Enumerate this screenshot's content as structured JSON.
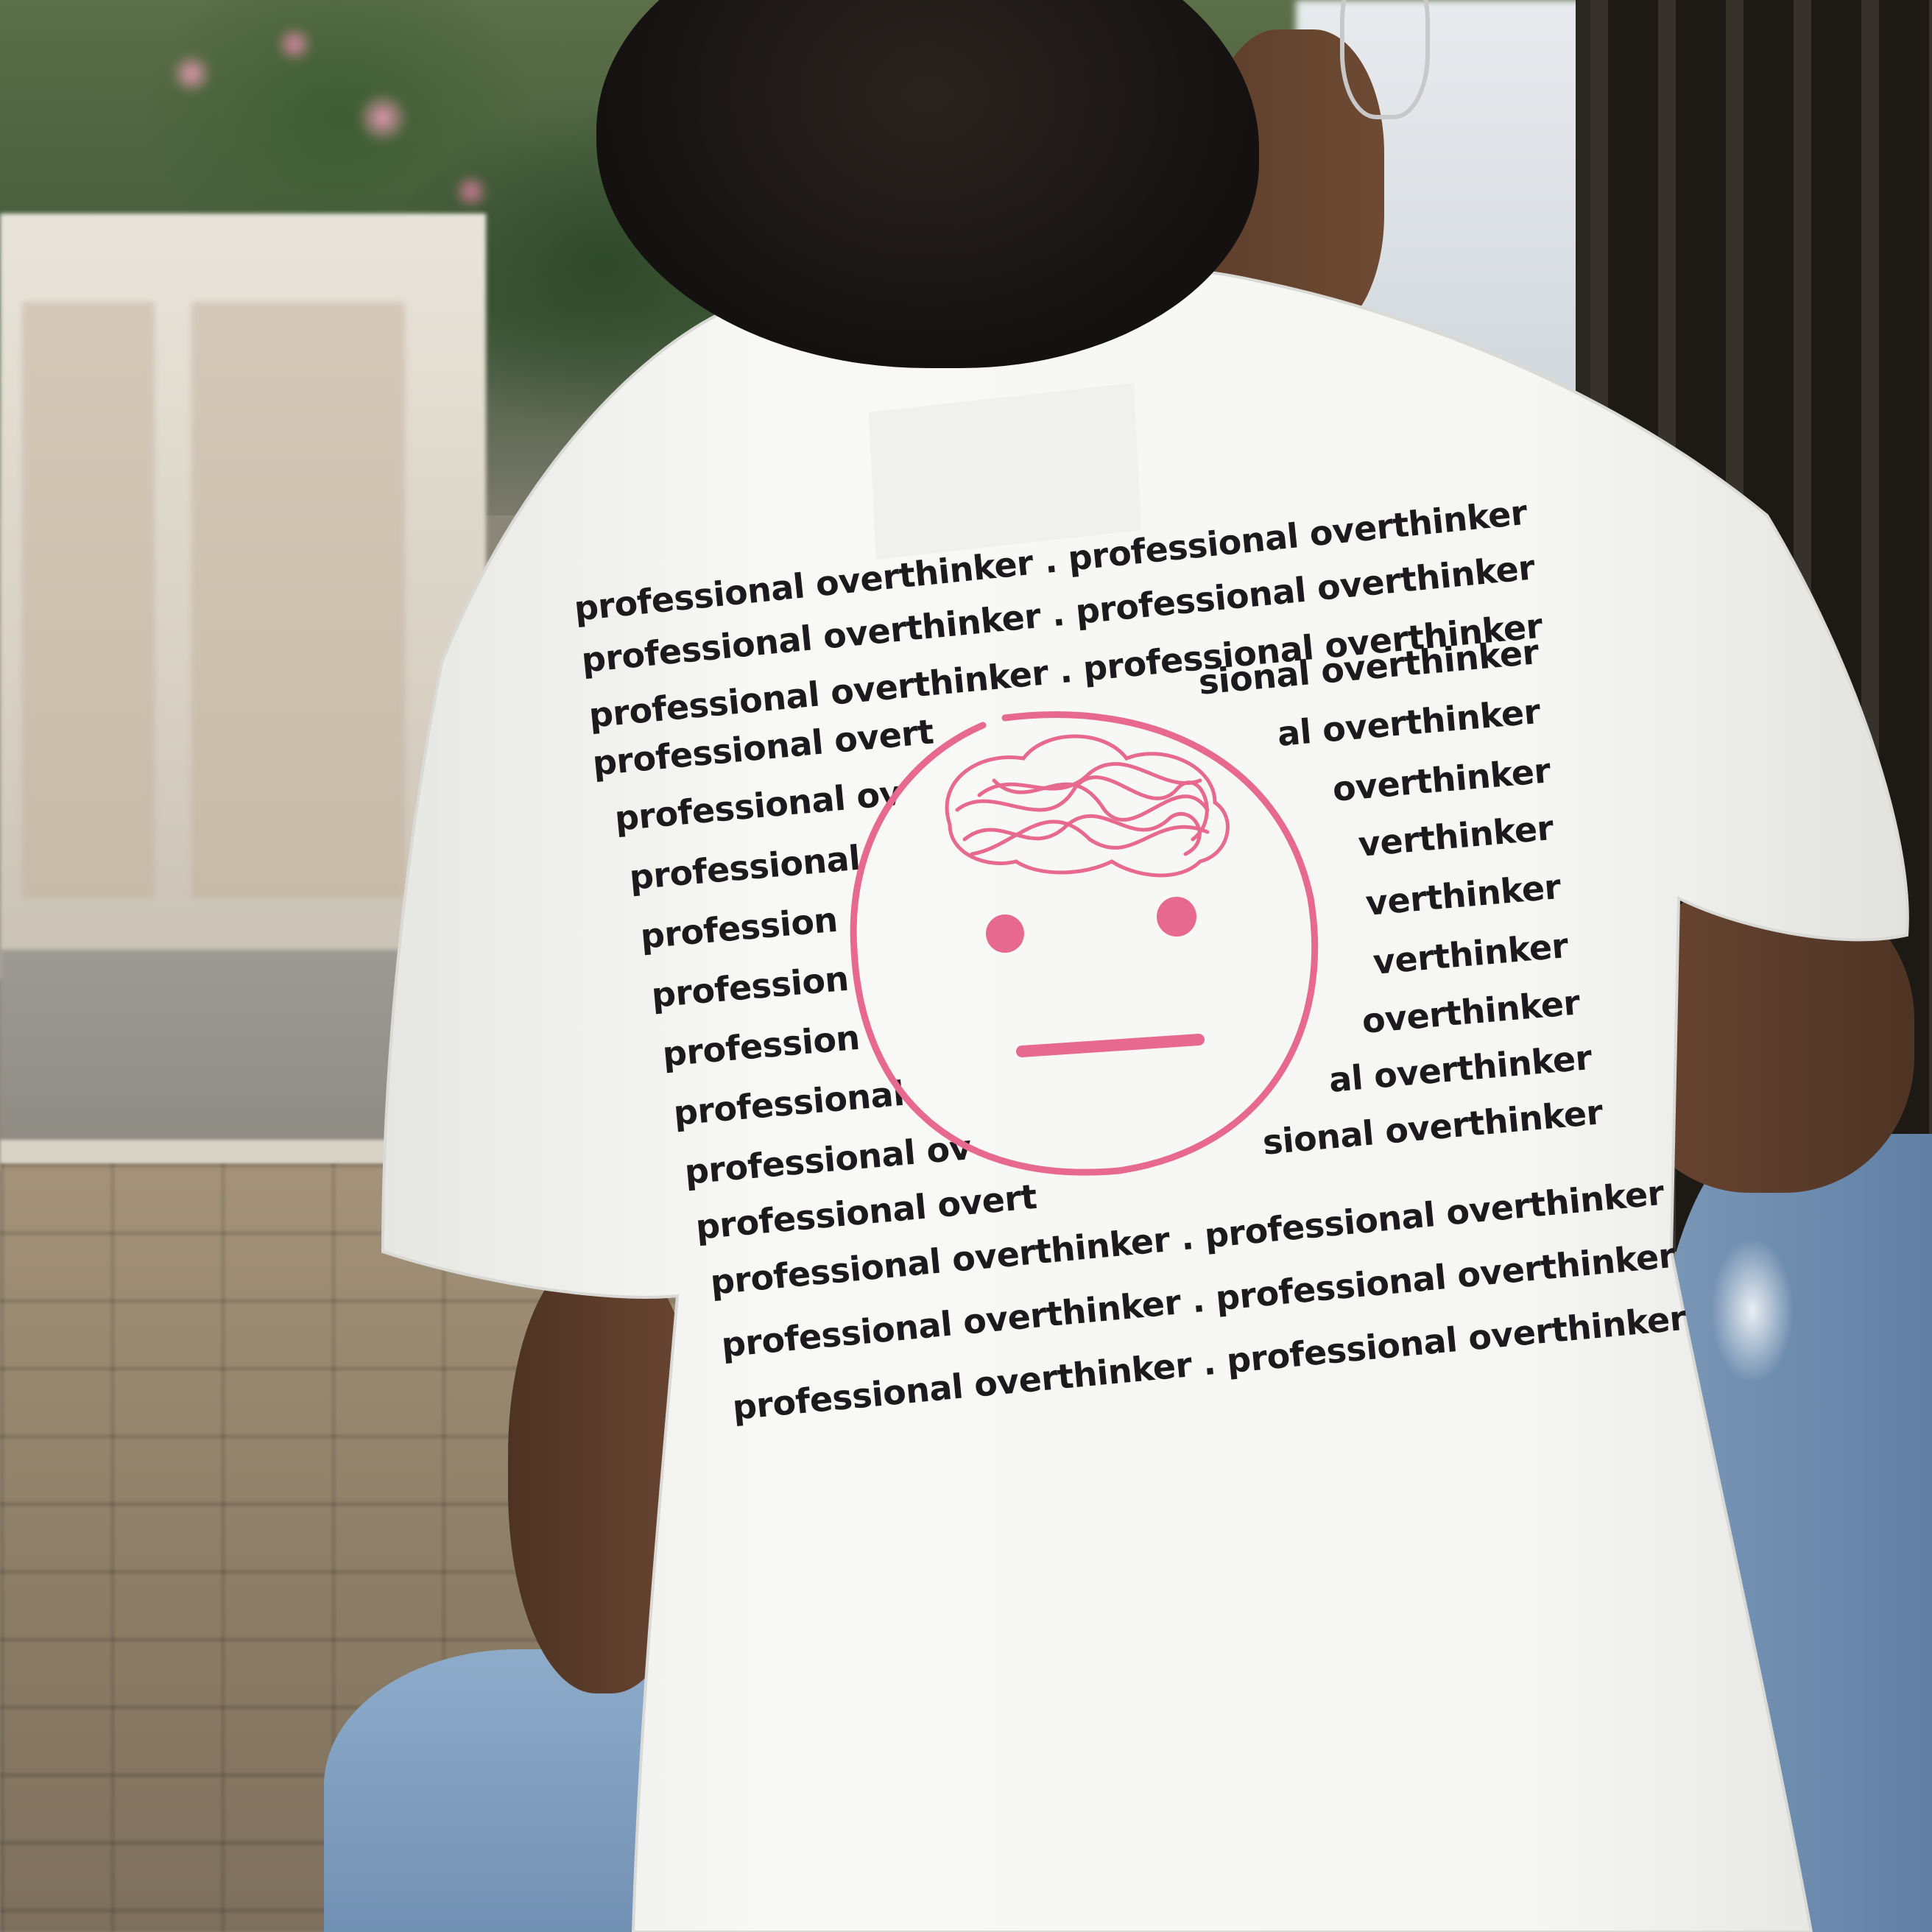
{
  "image": {
    "subject": "person-back-wearing-white-tshirt",
    "colors": {
      "shirt": "#f7f7f5",
      "print_text": "#1c1a1c",
      "print_face": "#e8698f",
      "skin": "#6b4632",
      "hair": "#1b1715",
      "denim": "#7693b4"
    }
  },
  "shirt_print": {
    "face_icon": "scribble-brain-neutral-face-icon",
    "lines": {
      "l0": {
        "left": "professional overthinker",
        "sep": ".",
        "right": "professional overthinker"
      },
      "l1": {
        "left": "professional overthinker",
        "sep": ".",
        "right": "professional overthinker"
      },
      "l2": {
        "left": "professional overthinker",
        "sep": ".",
        "right": "professional overthinker"
      },
      "l3": {
        "left": "professional overt",
        "right": "sional overthinker"
      },
      "l4": {
        "left": "professional ov",
        "right": "al overthinker"
      },
      "l5": {
        "left": "professional",
        "right": "overthinker"
      },
      "l6": {
        "left": "profession",
        "right": "verthinker"
      },
      "l7": {
        "left": "profession",
        "right": "verthinker"
      },
      "l8": {
        "left": "profession",
        "right": "verthinker"
      },
      "l9": {
        "left": "professional",
        "right": "overthinker"
      },
      "l10": {
        "left": "professional ov",
        "right": "al overthinker"
      },
      "l11": {
        "left": "professional overt",
        "right": "sional overthinker"
      },
      "l12": {
        "left": "professional overthinker",
        "sep": ".",
        "right": "professional overthinker"
      },
      "l13": {
        "left": "professional overthinker",
        "sep": ".",
        "right": "professional overthinker"
      },
      "l14": {
        "left": "professional overthinker",
        "sep": ".",
        "right": "professional overthinker"
      }
    }
  }
}
